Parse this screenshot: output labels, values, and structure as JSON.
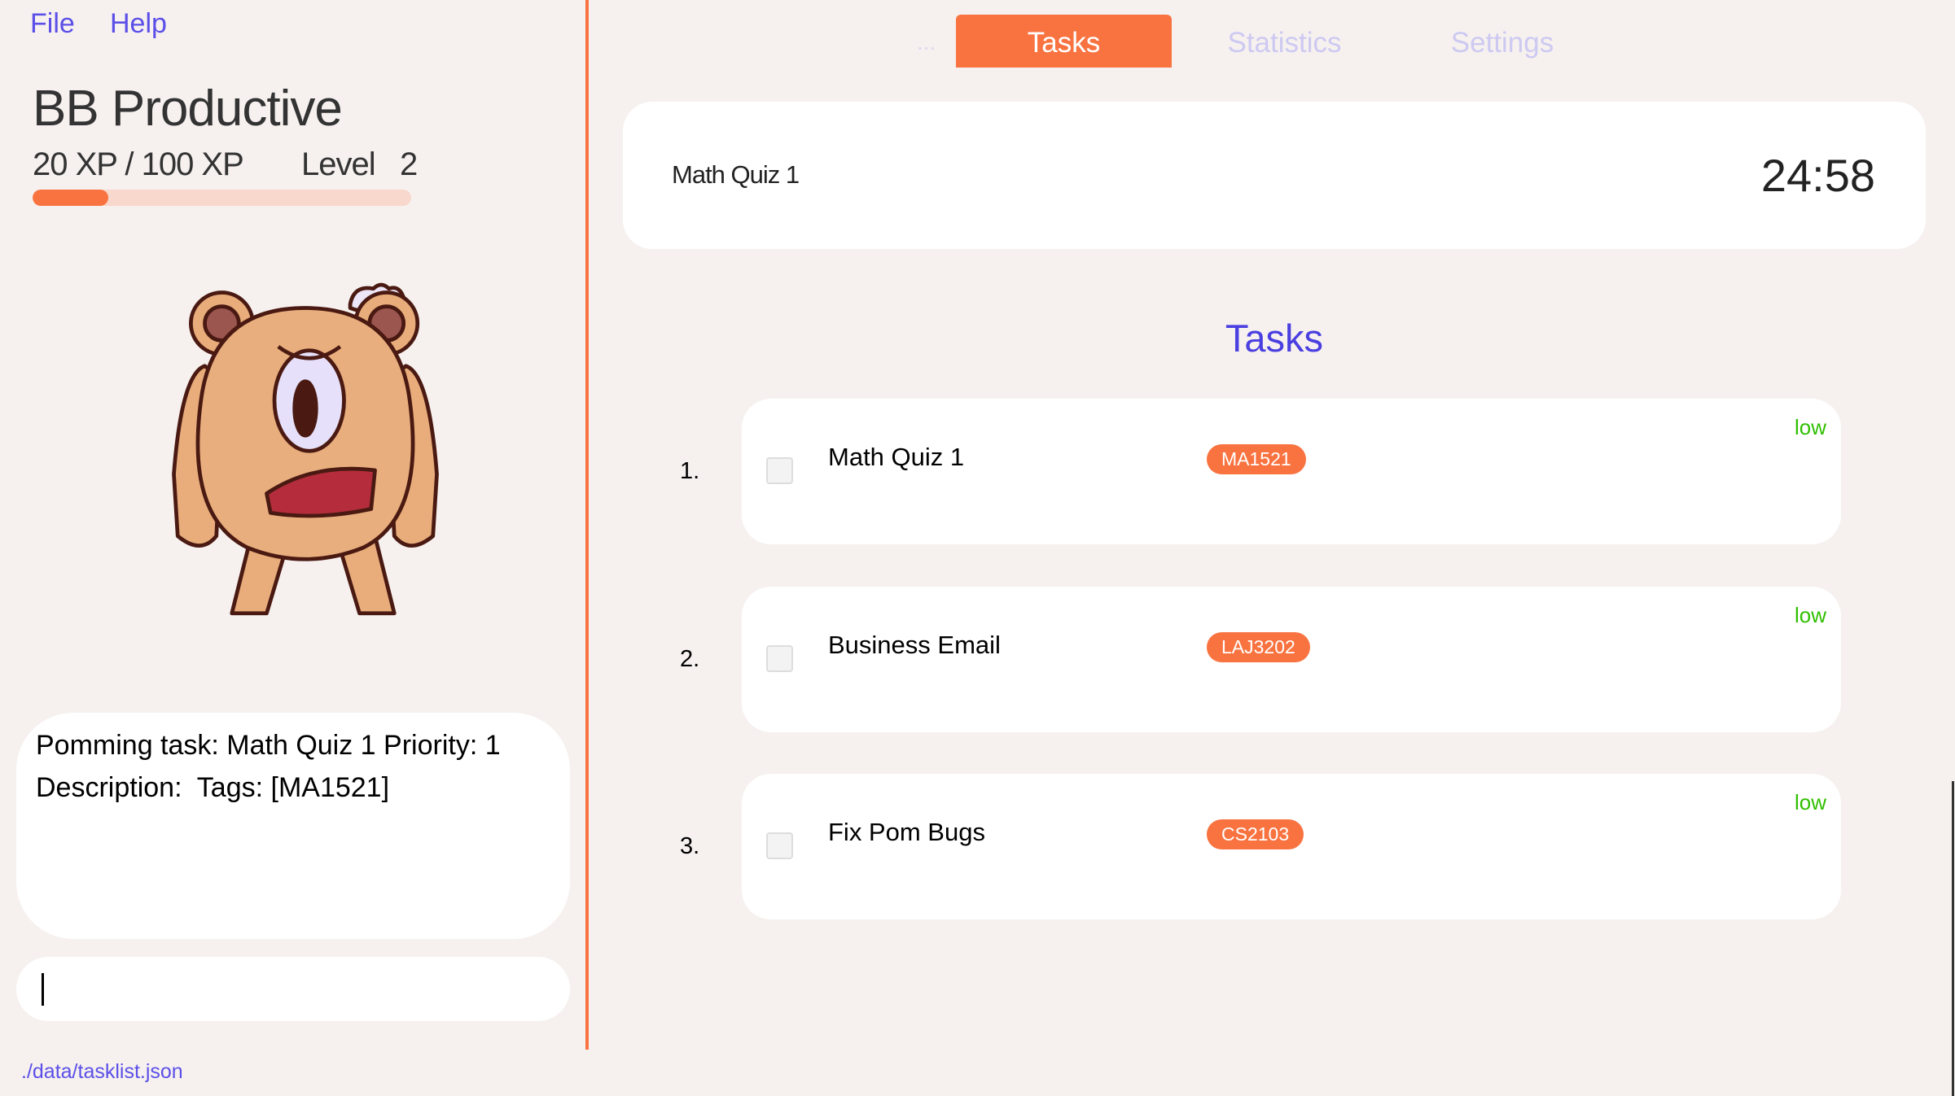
{
  "menu": {
    "file": "File",
    "help": "Help"
  },
  "sidebar": {
    "title": "BB Productive",
    "xp_text": "20 XP / 100 XP",
    "level_text": "Level   2",
    "xp_progress_percent": 20,
    "mascot": "angry-cyclops-bear",
    "details_line1": "Pomming task: Math Quiz 1 Priority: 1",
    "details_line2": "Description:  Tags: [MA1521]",
    "command_value": "",
    "file_path": "./data/tasklist.json"
  },
  "tabs": {
    "overflow": "...",
    "tasks": "Tasks",
    "statistics": "Statistics",
    "settings": "Settings",
    "active": "Tasks"
  },
  "timer": {
    "task": "Math Quiz 1",
    "time": "24:58"
  },
  "tasks_heading": "Tasks",
  "tasks": [
    {
      "index": "1.",
      "name": "Math Quiz 1",
      "tag": "MA1521",
      "priority": "low",
      "done": false
    },
    {
      "index": "2.",
      "name": "Business Email",
      "tag": "LAJ3202",
      "priority": "low",
      "done": false
    },
    {
      "index": "3.",
      "name": "Fix Pom Bugs",
      "tag": "CS2103",
      "priority": "low",
      "done": false
    }
  ],
  "colors": {
    "accent": "#f97340",
    "link": "#5b4fe8",
    "priority_low": "#2fbf00",
    "background": "#f6f1ef"
  }
}
